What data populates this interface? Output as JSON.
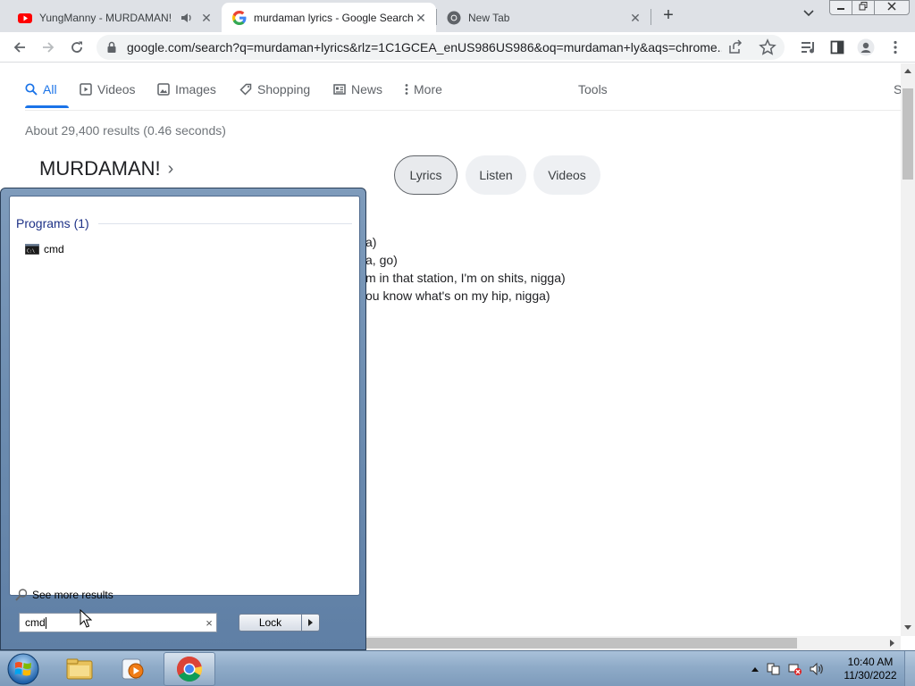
{
  "browser": {
    "tabs": [
      {
        "title": "YungManny - MURDAMAN!",
        "favicon": "youtube-icon",
        "audio": "speaker-icon"
      },
      {
        "title": "murdaman lyrics - Google Search",
        "favicon": "google-icon",
        "active": true
      },
      {
        "title": "New Tab",
        "favicon": "chrome-icon"
      }
    ],
    "new_tab": "+",
    "url": "google.com/search?q=murdaman+lyrics&rlz=1C1GCEA_enUS986US986&oq=murdaman+ly&aqs=chrome...."
  },
  "search_tabs": {
    "all": "All",
    "videos": "Videos",
    "images": "Images",
    "shopping": "Shopping",
    "news": "News",
    "more": "More",
    "tools": "Tools",
    "s": "S"
  },
  "results": {
    "stats": "About 29,400 results (0.46 seconds)",
    "kp_title": "MURDAMAN!",
    "chips": [
      "Lyrics",
      "Listen",
      "Videos"
    ],
    "lyrics": [
      "a)",
      "a, go)",
      "m in that station, I'm on shits, nigga)",
      "ou know what's on my hip, nigga)"
    ]
  },
  "start_menu": {
    "section": "Programs (1)",
    "program": "cmd",
    "see_more": "See more results",
    "search_value": "cmd",
    "lock": "Lock"
  },
  "taskbar": {
    "time": "10:40 AM",
    "date": "11/30/2022",
    "accent": "#1a73e8"
  }
}
